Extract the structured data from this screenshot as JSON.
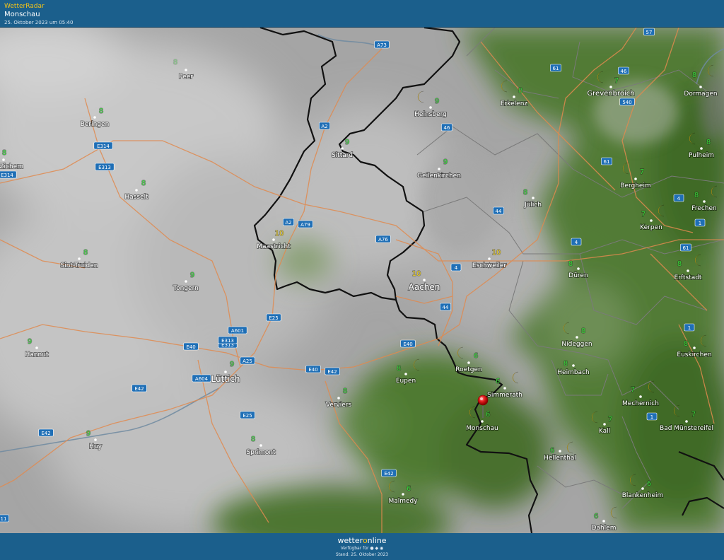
{
  "header": {
    "brand": "WetterRadar",
    "place": "Monschau",
    "timestamp": "25. Oktober 2023 um 05:40"
  },
  "footer": {
    "logo_a": "wetter",
    "logo_o": "o",
    "logo_b": "nline",
    "available": "Verfügbar für ● ◆ ◉",
    "stand": "Stand: 25. Oktober 2023"
  },
  "colors": {
    "bar": "#1b5f8c",
    "cloud": "#c9c9c9",
    "green": "#4f7a33",
    "road": "#e08a4f",
    "border": "#1a1a1a",
    "temp_green": "#36d43a",
    "temp_yellow": "#f2d21a",
    "moon": "#f2c21b"
  },
  "marker": {
    "name": "location-pin-icon",
    "city": "Monschau"
  },
  "cities": [
    {
      "name": "Peer",
      "temp": "8",
      "moon": false,
      "dim": true
    },
    {
      "name": "Heinsberg",
      "temp": "9",
      "moon": true
    },
    {
      "name": "Erkelenz",
      "temp": "8",
      "moon": true
    },
    {
      "name": "Grevenbroich",
      "temp": "7",
      "moon": true
    },
    {
      "name": "Dormagen",
      "temp": "8",
      "moon": true
    },
    {
      "name": "Beringen",
      "temp": "8",
      "moon": false
    },
    {
      "name": "Sittard",
      "temp": "9",
      "moon": false
    },
    {
      "name": "Geilenkirchen",
      "temp": "9",
      "moon": false
    },
    {
      "name": "Pulheim",
      "temp": "8",
      "moon": true
    },
    {
      "name": "uvel-Zichem",
      "temp": "8",
      "moon": false
    },
    {
      "name": "Hasselt",
      "temp": "8",
      "moon": false
    },
    {
      "name": "Jülich",
      "temp": "8",
      "moon": false
    },
    {
      "name": "Bergheim",
      "temp": "7",
      "moon": true
    },
    {
      "name": "Frechen",
      "temp": "8",
      "moon": true
    },
    {
      "name": "Kerpen",
      "temp": "7",
      "moon": true
    },
    {
      "name": "Maastricht",
      "temp": "10",
      "moon": false
    },
    {
      "name": "Eschweiler",
      "temp": "10",
      "moon": false
    },
    {
      "name": "Sint-Truiden",
      "temp": "8",
      "moon": false
    },
    {
      "name": "Düren",
      "temp": "8",
      "moon": false
    },
    {
      "name": "Erftstadt",
      "temp": "8",
      "moon": true
    },
    {
      "name": "Aachen",
      "temp": "10",
      "moon": false
    },
    {
      "name": "Tongern",
      "temp": "9",
      "moon": false
    },
    {
      "name": "Hannut",
      "temp": "9",
      "moon": false
    },
    {
      "name": "Nideggen",
      "temp": "8",
      "moon": true
    },
    {
      "name": "Euskirchen",
      "temp": "8",
      "moon": true
    },
    {
      "name": "Lüttich",
      "temp": "9",
      "moon": false
    },
    {
      "name": "Eupen",
      "temp": "8",
      "moon": true
    },
    {
      "name": "Roetgen",
      "temp": "6",
      "moon": true
    },
    {
      "name": "Heimbach",
      "temp": "8",
      "moon": false
    },
    {
      "name": "Simmerath",
      "temp": "6",
      "moon": true
    },
    {
      "name": "Mechernich",
      "temp": "7",
      "moon": true
    },
    {
      "name": "Verviers",
      "temp": "8",
      "moon": false
    },
    {
      "name": "Monschau",
      "temp": "6",
      "moon": true
    },
    {
      "name": "Kall",
      "temp": "7",
      "moon": true
    },
    {
      "name": "Bad Münstereifel",
      "temp": "7",
      "moon": true
    },
    {
      "name": "Huy",
      "temp": "9",
      "moon": false
    },
    {
      "name": "Sprimont",
      "temp": "8",
      "moon": false
    },
    {
      "name": "Hellenthal",
      "temp": "6",
      "moon": true
    },
    {
      "name": "Blankenheim",
      "temp": "6",
      "moon": true
    },
    {
      "name": "Malmedy",
      "temp": "6",
      "moon": true
    },
    {
      "name": "Dahlem",
      "temp": "6",
      "moon": true
    }
  ],
  "roads": [
    "A73",
    "57",
    "61",
    "46",
    "540",
    "A2",
    "46",
    "E314",
    "E313",
    "E314",
    "61",
    "4",
    "A2",
    "A79",
    "1",
    "44",
    "E313",
    "A76",
    "61",
    "4",
    "4",
    "44",
    "E25",
    "1",
    "A601",
    "E40",
    "E313",
    "E40",
    "A25",
    "E40",
    "E42",
    "A604",
    "E42",
    "E25",
    "1",
    "E42",
    "E42",
    "11"
  ]
}
